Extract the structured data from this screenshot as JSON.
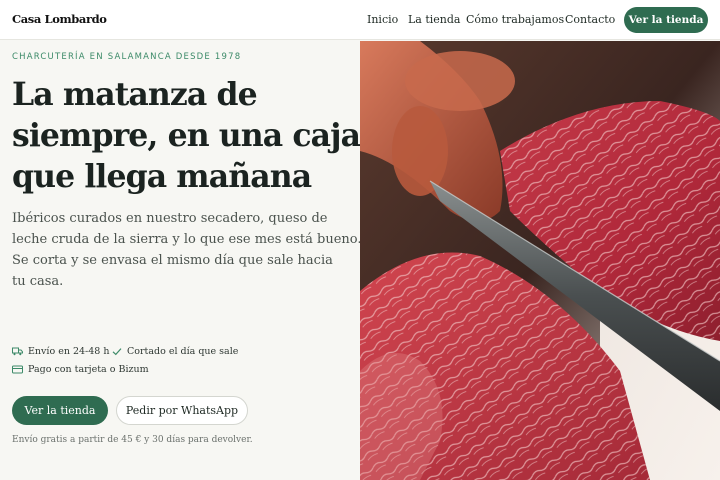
{
  "brand": "Casa Lombardo",
  "nav": {
    "links": [
      "Inicio",
      "La tienda",
      "Cómo trabajamos",
      "Contacto"
    ],
    "cta": "Ver la tienda"
  },
  "hero": {
    "eyebrow": "CHARCUTERÍA EN SALAMANCA DESDE 1978",
    "headline": [
      "La matanza de",
      "siempre, en una caja",
      "que llega mañana"
    ],
    "lede": [
      "Ibéricos curados en nuestro secadero, queso de",
      "leche cruda de la sierra y lo que ese mes está bueno.",
      "Se corta y se envasa el mismo día que sale hacia",
      "tu casa."
    ],
    "features": [
      {
        "icon": "truck-icon",
        "text": "Envío en 24-48 h"
      },
      {
        "icon": "check-icon",
        "text": "Cortado el día que sale"
      },
      {
        "icon": "card-icon",
        "text": "Pago con tarjeta o Bizum"
      }
    ],
    "primary_button": "Ver la tienda",
    "secondary_button": "Pedir por WhatsApp",
    "footnote": "Envío gratis a partir de 45 € y 30 días para devolver."
  },
  "colors": {
    "accent": "#2f6c51",
    "eyebrow": "#3c8a68",
    "background": "#f7f7f3"
  }
}
